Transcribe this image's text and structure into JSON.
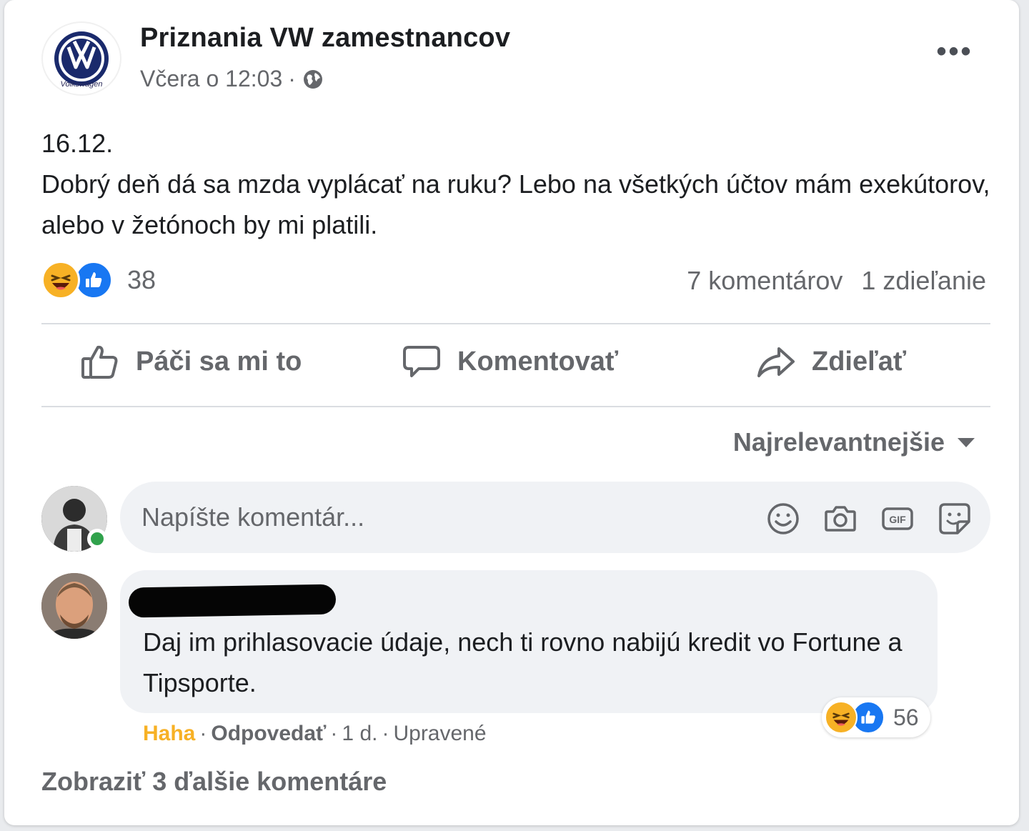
{
  "post": {
    "page_name": "Priznania VW zamestnancov",
    "page_logo_text": "Volkswagen",
    "time": "Včera o 12:03",
    "separator": "·",
    "privacy_icon": "globe-icon",
    "more_icon": "more-options-icon",
    "date_line": "16.12.",
    "body": "Dobrý deň dá sa mzda vyplácať na ruku? Lebo na všetkých účtov mám exekútorov, alebo v žetónoch by mi platili.",
    "reactions": [
      "haha",
      "like"
    ],
    "reaction_count": "38",
    "comments_count": "7 komentárov",
    "shares_count": "1 zdieľanie"
  },
  "actions": {
    "like_label": "Páči sa mi to",
    "comment_label": "Komentovať",
    "share_label": "Zdieľať"
  },
  "sort": {
    "label": "Najrelevantnejšie"
  },
  "composer": {
    "placeholder": "Napíšte komentár...",
    "icons": [
      "emoji-icon",
      "camera-icon",
      "gif-icon",
      "sticker-icon"
    ]
  },
  "comment": {
    "text": "Daj im prihlasovacie údaje, nech ti rovno nabijú kredit vo Fortune a Tipsporte.",
    "reaction_count": "56",
    "reactions": [
      "haha",
      "like"
    ],
    "haha_label": "Haha",
    "reply_label": "Odpovedať",
    "age": "1 d.",
    "edited_label": "Upravené"
  },
  "more_comments": "Zobraziť 3 ďalšie komentáre",
  "colors": {
    "haha": "#f7b125",
    "like": "#1877f2",
    "secondary_text": "#65676b",
    "online": "#31a24c"
  }
}
